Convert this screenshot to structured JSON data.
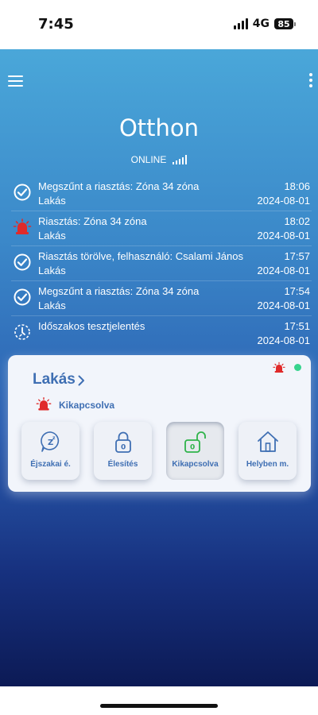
{
  "status_bar": {
    "time": "7:45",
    "network": "4G",
    "battery": "85"
  },
  "header": {
    "title": "Otthon",
    "connection": "ONLINE"
  },
  "events": [
    {
      "icon": "check-circle-icon",
      "description": "Megszűnt a riasztás: Zóna 34 zóna",
      "area": "Lakás",
      "time": "18:06",
      "date": "2024-08-01"
    },
    {
      "icon": "siren-icon",
      "description": "Riasztás: Zóna 34 zóna",
      "area": "Lakás",
      "time": "18:02",
      "date": "2024-08-01"
    },
    {
      "icon": "check-circle-icon",
      "description": "Riasztás törölve, felhasználó: Csalami János",
      "area": "Lakás",
      "time": "17:57",
      "date": "2024-08-01"
    },
    {
      "icon": "check-circle-icon",
      "description": "Megszűnt a riasztás: Zóna 34 zóna",
      "area": "Lakás",
      "time": "17:54",
      "date": "2024-08-01"
    },
    {
      "icon": "test-report-icon",
      "description": "Időszakos tesztjelentés",
      "area": "",
      "time": "17:51",
      "date": "2024-08-01"
    }
  ],
  "area_card": {
    "name": "Lakás",
    "state": "Kikapcsolva",
    "modes": [
      {
        "label": "Éjszakai é.",
        "icon": "night-sleep-icon",
        "active": false
      },
      {
        "label": "Élesítés",
        "icon": "lock-closed-icon",
        "active": false
      },
      {
        "label": "Kikapcsolva",
        "icon": "lock-open-icon",
        "active": true
      },
      {
        "label": "Helyben m.",
        "icon": "home-icon",
        "active": false
      }
    ]
  },
  "colors": {
    "accent": "#3f6fb3",
    "alarm_red": "#e02a2a",
    "online_green": "#37d48e",
    "disarmed_green": "#2fb34a"
  }
}
